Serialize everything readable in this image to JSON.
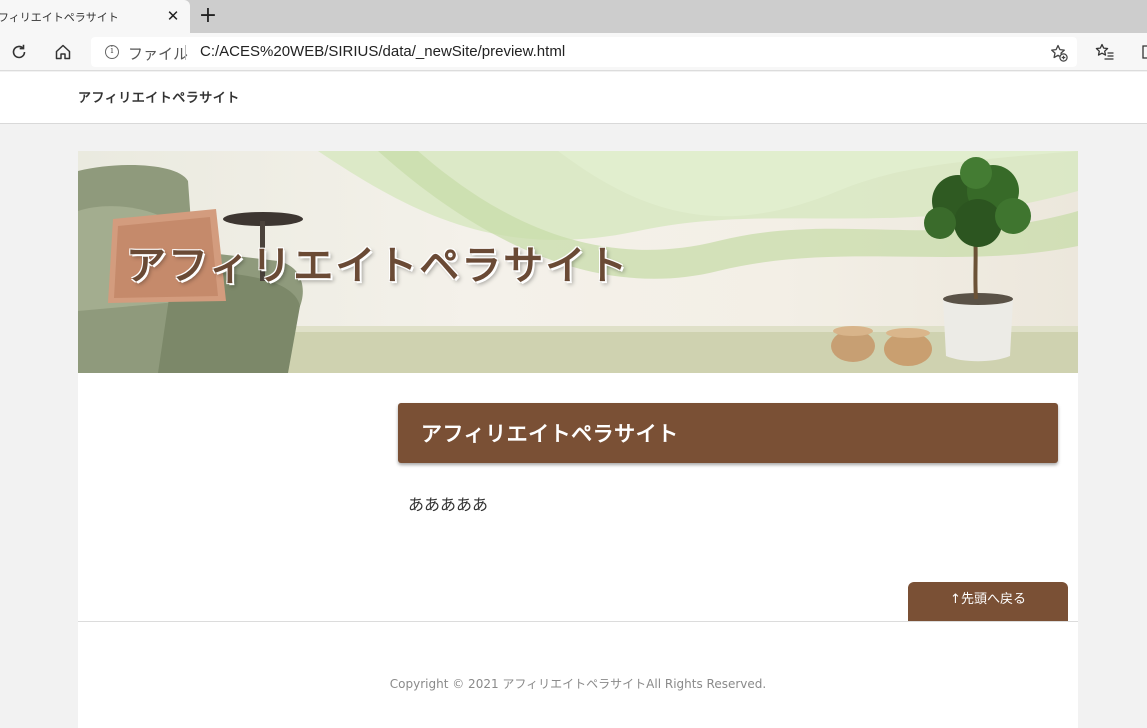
{
  "browser": {
    "tab_title": "フィリエイトペラサイト",
    "tab_close": "✕",
    "new_tab": "+",
    "address": {
      "scheme_label": "ファイル",
      "url": "C:/ACES%20WEB/SIRIUS/data/_newSite/preview.html"
    }
  },
  "site": {
    "logo_text": "アフィリエイトペラサイト",
    "hero_title": "アフィリエイトペラサイト",
    "content_heading": "アフィリエイトペラサイト",
    "content_body": "あああああ",
    "pagetop_label": "↑先頭へ戻る",
    "copyright": "Copyright © 2021 アフィリエイトペラサイトAll Rights Reserved."
  },
  "colors": {
    "accent_brown": "#7a5035",
    "hero_title": "#6a4a35",
    "page_bg": "#f2f2f2"
  }
}
